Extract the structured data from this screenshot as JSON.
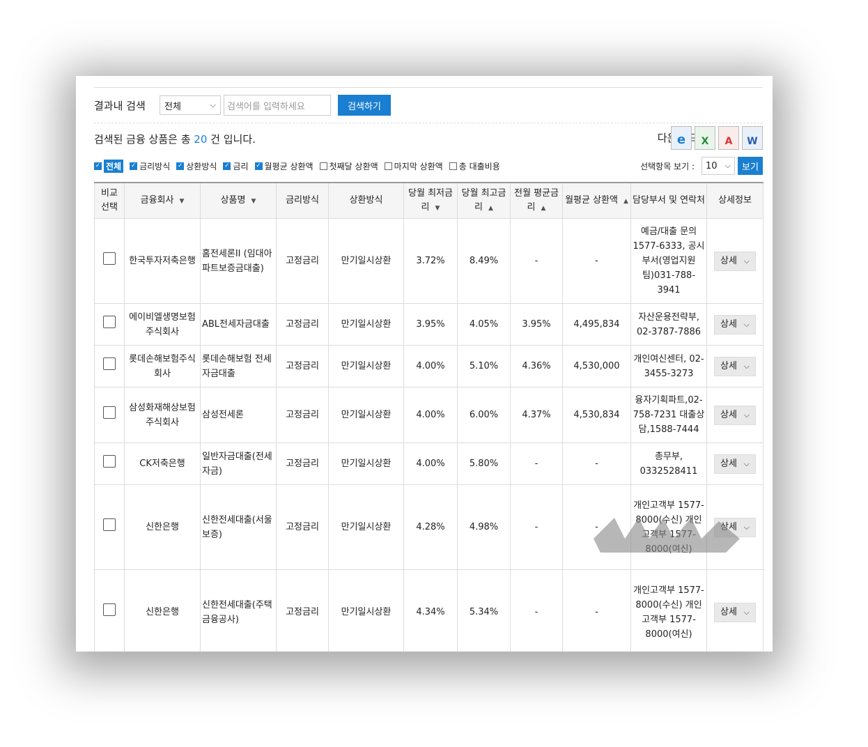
{
  "search": {
    "label": "결과내 검색",
    "scope": "전체",
    "placeholder": "검색어를 입력하세요",
    "button": "검색하기"
  },
  "summary": {
    "prefix": "검색된 금융 상품은 총",
    "count": "20",
    "suffix": "건 입니다."
  },
  "download": {
    "label": "다운로드",
    "icons": [
      "ie-icon",
      "excel-icon",
      "pdf-icon",
      "word-icon"
    ]
  },
  "filters": [
    {
      "label": "전체",
      "checked": true
    },
    {
      "label": "금리방식",
      "checked": true
    },
    {
      "label": "상환방식",
      "checked": true
    },
    {
      "label": "금리",
      "checked": true
    },
    {
      "label": "월평균 상환액",
      "checked": true
    },
    {
      "label": "첫째달 상환액",
      "checked": false
    },
    {
      "label": "마지막 상환액",
      "checked": false
    },
    {
      "label": "총 대출비용",
      "checked": false
    }
  ],
  "view": {
    "label": "선택항목 보기 :",
    "count": "10",
    "button": "보기"
  },
  "table": {
    "headers": {
      "compare": "비교 선택",
      "company": "금융회사",
      "product": "상품명",
      "rate_type": "금리방식",
      "repay": "상환방식",
      "min_rate": "당월 최저금리",
      "max_rate": "당월 최고금리",
      "avg_rate": "전월 평균금리",
      "monthly": "월평균 상환액",
      "contact": "담당부서 및 연락처",
      "detail": "상세정보"
    },
    "rows": [
      {
        "company": "한국투자저축은행",
        "product": "홈전세론II (임대아파트보증금대출)",
        "rate_type": "고정금리",
        "repay": "만기일시상환",
        "min_rate": "3.72%",
        "max_rate": "8.49%",
        "avg_rate": "-",
        "monthly": "-",
        "contact": "예금/대출 문의 1577-6333, 공시부서(영업지원팀)031-788-3941",
        "detail": "상세"
      },
      {
        "company": "에이비엘생명보험주식회사",
        "product": "ABL전세자금대출",
        "rate_type": "고정금리",
        "repay": "만기일시상환",
        "min_rate": "3.95%",
        "max_rate": "4.05%",
        "avg_rate": "3.95%",
        "monthly": "4,495,834",
        "contact": "자산운용전략부, 02-3787-7886",
        "detail": "상세"
      },
      {
        "company": "롯데손해보험주식회사",
        "product": "롯데손해보험 전세자금대출",
        "rate_type": "고정금리",
        "repay": "만기일시상환",
        "min_rate": "4.00%",
        "max_rate": "5.10%",
        "avg_rate": "4.36%",
        "monthly": "4,530,000",
        "contact": "개인여신센터, 02-3455-3273",
        "detail": "상세"
      },
      {
        "company": "삼성화재해상보험주식회사",
        "product": "삼성전세론",
        "rate_type": "고정금리",
        "repay": "만기일시상환",
        "min_rate": "4.00%",
        "max_rate": "6.00%",
        "avg_rate": "4.37%",
        "monthly": "4,530,834",
        "contact": "융자기획파트,02-758-7231 대출상담,1588-7444",
        "detail": "상세"
      },
      {
        "company": "CK저축은행",
        "product": "일반자금대출(전세자금)",
        "rate_type": "고정금리",
        "repay": "만기일시상환",
        "min_rate": "4.00%",
        "max_rate": "5.80%",
        "avg_rate": "-",
        "monthly": "-",
        "contact": "총무부, 0332528411",
        "detail": "상세"
      },
      {
        "company": "신한은행",
        "product": "신한전세대출(서울보증)",
        "rate_type": "고정금리",
        "repay": "만기일시상환",
        "min_rate": "4.28%",
        "max_rate": "4.98%",
        "avg_rate": "-",
        "monthly": "-",
        "contact": "개인고객부 1577-8000(수신) 개인고객부 1577-8000(여신)",
        "detail": "상세"
      },
      {
        "company": "신한은행",
        "product": "신한전세대출(주택금융공사)",
        "rate_type": "고정금리",
        "repay": "만기일시상환",
        "min_rate": "4.34%",
        "max_rate": "5.34%",
        "avg_rate": "-",
        "monthly": "-",
        "contact": "개인고객부 1577-8000(수신) 개인고객부 1577-8000(여신)",
        "detail": "상세"
      }
    ]
  }
}
